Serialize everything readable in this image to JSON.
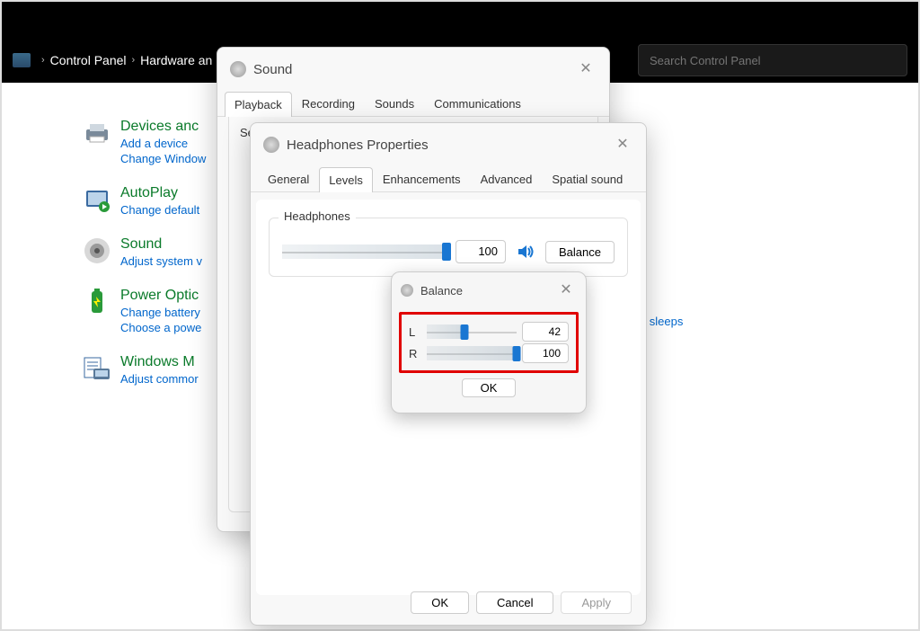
{
  "addressbar": {
    "breadcrumb": [
      "Control Panel",
      "Hardware an"
    ],
    "search_placeholder": "Search Control Panel"
  },
  "cp_items": [
    {
      "title": "Devices anc",
      "links": [
        "Add a device",
        "Change Window"
      ],
      "icon": "printer-icon"
    },
    {
      "title": "AutoPlay",
      "links": [
        "Change default"
      ],
      "icon": "autoplay-icon"
    },
    {
      "title": "Sound",
      "links": [
        "Adjust system v"
      ],
      "icon": "speaker-round-icon"
    },
    {
      "title": "Power Optic",
      "links": [
        "Change battery",
        "Choose a powe"
      ],
      "icon": "power-battery-icon"
    },
    {
      "title": "Windows M",
      "links": [
        "Adjust commor"
      ],
      "icon": "mobility-icon"
    }
  ],
  "cp_extra_link": "ter sleeps",
  "sound_dialog": {
    "title": "Sound",
    "tabs": [
      "Playback",
      "Recording",
      "Sounds",
      "Communications"
    ],
    "active_tab": 0,
    "body_hint": "Sel"
  },
  "headphones_dialog": {
    "title": "Headphones Properties",
    "tabs": [
      "General",
      "Levels",
      "Enhancements",
      "Advanced",
      "Spatial sound"
    ],
    "active_tab": 1,
    "group_label": "Headphones",
    "level_value": 100,
    "balance_button": "Balance",
    "footer": {
      "ok": "OK",
      "cancel": "Cancel",
      "apply": "Apply"
    }
  },
  "balance_dialog": {
    "title": "Balance",
    "left_label": "L",
    "right_label": "R",
    "left_value": 42,
    "right_value": 100,
    "ok": "OK"
  }
}
